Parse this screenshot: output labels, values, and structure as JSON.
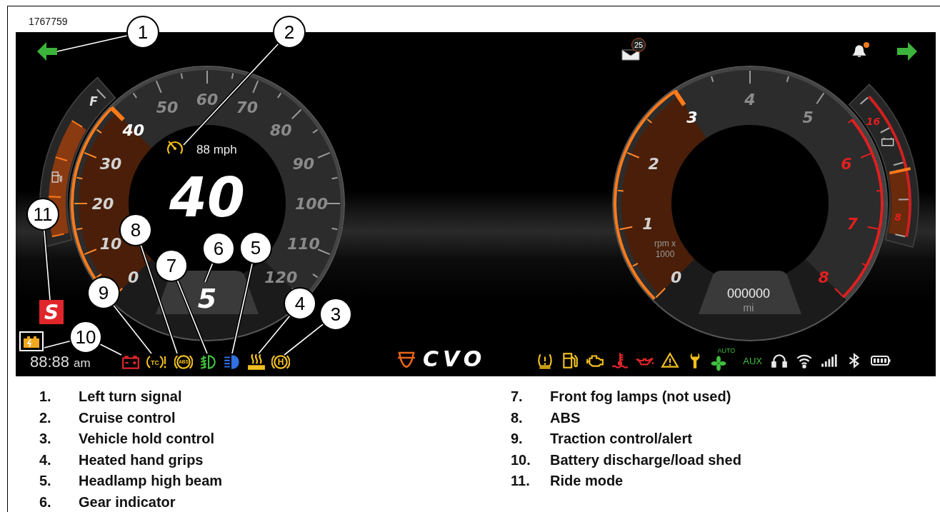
{
  "figure_id": "1767759",
  "top_bar": {
    "left_turn_signal": {
      "on": true
    },
    "messages": {
      "count": "25"
    },
    "notifications": {
      "unread": true
    },
    "right_turn_signal": {
      "on": true
    }
  },
  "speedometer": {
    "labels": [
      {
        "text": "0",
        "pointer": false
      },
      {
        "text": "10",
        "pointer": false
      },
      {
        "text": "20",
        "pointer": false
      },
      {
        "text": "30",
        "pointer": false
      },
      {
        "text": "40",
        "pointer": true
      },
      {
        "text": "50",
        "pointer": false
      },
      {
        "text": "60",
        "pointer": false
      },
      {
        "text": "70",
        "pointer": false
      },
      {
        "text": "80",
        "pointer": false
      },
      {
        "text": "90",
        "pointer": false
      },
      {
        "text": "100",
        "pointer": false
      },
      {
        "text": "110",
        "pointer": false
      },
      {
        "text": "120",
        "pointer": false
      }
    ],
    "speed": "40",
    "cruise": {
      "active": true,
      "speed": "88 mph"
    },
    "gear": "5"
  },
  "fuel_gauge": {
    "label": "F",
    "segments": [
      {
        "lit": true
      },
      {
        "lit": true
      },
      {
        "lit": true
      },
      {
        "lit": false
      }
    ]
  },
  "tachometer": {
    "labels": [
      {
        "text": "0",
        "redline": false,
        "pointer": false
      },
      {
        "text": "1",
        "redline": false,
        "pointer": false
      },
      {
        "text": "2",
        "redline": false,
        "pointer": false
      },
      {
        "text": "3",
        "redline": false,
        "pointer": true
      },
      {
        "text": "4",
        "redline": false,
        "pointer": false
      },
      {
        "text": "5",
        "redline": false,
        "pointer": false
      },
      {
        "text": "6",
        "redline": true,
        "pointer": false
      },
      {
        "text": "7",
        "redline": true,
        "pointer": false
      },
      {
        "text": "8",
        "redline": true,
        "pointer": false
      }
    ],
    "unit": [
      "rpm x",
      "1000"
    ],
    "odometer": "000000",
    "odometer_unit": "mi"
  },
  "voltage_gauge": {
    "labels": [
      "16",
      "8"
    ],
    "level": 0.45
  },
  "ride_mode": {
    "label": "S"
  },
  "clock": {
    "time": "88:88",
    "period": "am"
  },
  "left_indicators": [
    {
      "kind": "battery",
      "color": "#e0262b"
    },
    {
      "kind": "tc",
      "label": "TC",
      "color": "#f2c01e"
    },
    {
      "kind": "abs",
      "label": "ABS",
      "color": "#f2c01e"
    },
    {
      "kind": "fog",
      "color": "#3fbf3f"
    },
    {
      "kind": "beam",
      "color": "#2f6fe0"
    },
    {
      "kind": "grips",
      "color": "#f2c01e"
    },
    {
      "kind": "hold",
      "label": "H",
      "color": "#f2c01e"
    }
  ],
  "brand": {
    "text": "CVO"
  },
  "right_indicators": [
    {
      "kind": "tpms",
      "color": "#f2c01e"
    },
    {
      "kind": "fuel",
      "color": "#f2c01e"
    },
    {
      "kind": "engine",
      "color": "#f2c01e"
    },
    {
      "kind": "coolant",
      "color": "#e0262b"
    },
    {
      "kind": "oil",
      "color": "#e0262b"
    },
    {
      "kind": "warning",
      "color": "#f2c01e"
    },
    {
      "kind": "wrench",
      "color": "#f2c01e"
    },
    {
      "kind": "fan",
      "label": "AUTO",
      "color": "#3fbf3f"
    },
    {
      "kind": "aux",
      "label": "AUX",
      "color": "#3fbf3f"
    },
    {
      "kind": "headset",
      "color": "#e8e8e8"
    },
    {
      "kind": "wifi",
      "color": "#e8e8e8"
    },
    {
      "kind": "signal",
      "color": "#e8e8e8"
    },
    {
      "kind": "bluetooth",
      "color": "#e8e8e8"
    },
    {
      "kind": "battlevel",
      "color": "#e8e8e8"
    }
  ],
  "callouts": [
    "1",
    "2",
    "3",
    "4",
    "5",
    "6",
    "7",
    "8",
    "9",
    "10",
    "11"
  ],
  "legend": [
    {
      "number": "1.",
      "text": "Left turn signal"
    },
    {
      "number": "2.",
      "text": "Cruise control"
    },
    {
      "number": "3.",
      "text": "Vehicle hold control"
    },
    {
      "number": "4.",
      "text": "Heated hand grips"
    },
    {
      "number": "5.",
      "text": "Headlamp high beam"
    },
    {
      "number": "6.",
      "text": "Gear indicator"
    },
    {
      "number": "7.",
      "text": "Front fog lamps (not used)"
    },
    {
      "number": "8.",
      "text": "ABS"
    },
    {
      "number": "9.",
      "text": "Traction control/alert"
    },
    {
      "number": "10.",
      "text": "Battery discharge/load shed"
    },
    {
      "number": "11.",
      "text": "Ride mode"
    }
  ]
}
